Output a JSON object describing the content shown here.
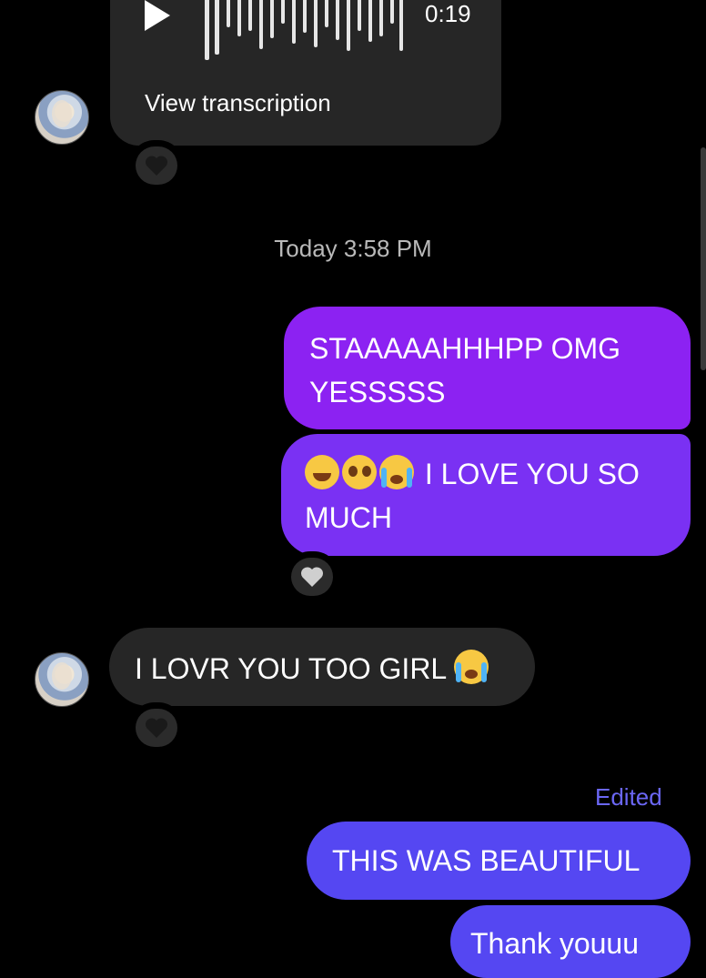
{
  "voice_message": {
    "duration": "0:19",
    "transcription_link": "View transcription"
  },
  "timestamp": "Today 3:58 PM",
  "messages": {
    "out_1": "STAAAAAHHHPP OMG YESSSSS",
    "out_2": "I LOVE YOU SO MUCH",
    "in_1": "I LOVR YOU TOO GIRL",
    "edited_label": "Edited",
    "out_3": "THIS WAS BEAUTIFUL",
    "out_4": "Thank youuu"
  },
  "icons": {
    "reaction": "heart-icon",
    "play": "play-icon",
    "emoji_1": "laughing-emoji",
    "emoji_2": "pleading-emoji",
    "emoji_3": "crying-emoji"
  },
  "colors": {
    "background": "#000000",
    "incoming_bubble": "#262626",
    "outgoing_1": "#8c22f2",
    "outgoing_2": "#7a31f3",
    "outgoing_3": "#5547f2",
    "edited": "#6b67f5"
  }
}
